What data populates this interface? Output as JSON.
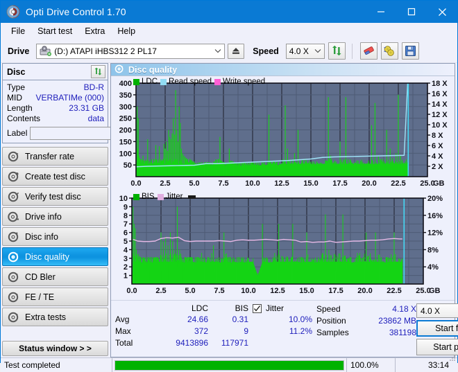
{
  "window": {
    "title": "Opti Drive Control 1.70",
    "icon": "disc-icon",
    "minimize": "minimize-icon",
    "maximize": "maximize-icon",
    "close": "close-icon"
  },
  "menu": [
    {
      "label": "File"
    },
    {
      "label": "Start test"
    },
    {
      "label": "Extra"
    },
    {
      "label": "Help"
    }
  ],
  "toolbar": {
    "drive_label": "Drive",
    "drive_value": "(D:)  ATAPI iHBS312  2 PL17",
    "eject_icon": "eject-icon",
    "speed_label": "Speed",
    "speed_value": "4.0 X",
    "refresh_icon": "refresh-icon",
    "erase_icon": "eraser-icon",
    "settings_icon": "gear-icon",
    "save_icon": "save-icon"
  },
  "disc_panel": {
    "title": "Disc",
    "refresh_icon": "refresh-icon",
    "rows": [
      {
        "key": "Type",
        "value": "BD-R"
      },
      {
        "key": "MID",
        "value": "VERBATIMe (000)"
      },
      {
        "key": "Length",
        "value": "23.31 GB"
      },
      {
        "key": "Contents",
        "value": "data"
      }
    ],
    "label_key": "Label",
    "label_value": "",
    "label_placeholder": "",
    "label_icon": "disc-yellow-icon"
  },
  "sidebar": {
    "items": [
      {
        "label": "Transfer rate",
        "icon": "disc-test-icon",
        "active": false
      },
      {
        "label": "Create test disc",
        "icon": "disc-test-icon",
        "active": false
      },
      {
        "label": "Verify test disc",
        "icon": "disc-test-icon",
        "active": false
      },
      {
        "label": "Drive info",
        "icon": "disc-test-icon",
        "active": false
      },
      {
        "label": "Disc info",
        "icon": "disc-test-icon",
        "active": false
      },
      {
        "label": "Disc quality",
        "icon": "disc-test-icon",
        "active": true
      },
      {
        "label": "CD Bler",
        "icon": "disc-test-icon",
        "active": false
      },
      {
        "label": "FE / TE",
        "icon": "disc-test-icon",
        "active": false
      },
      {
        "label": "Extra tests",
        "icon": "disc-test-icon",
        "active": false
      }
    ],
    "status_button": "Status window > >"
  },
  "main": {
    "title": "Disc quality",
    "title_icon": "disc-quality-icon"
  },
  "stats": {
    "col_headers": [
      "",
      "LDC",
      "BIS"
    ],
    "rows": [
      {
        "label": "Avg",
        "ldc": "24.66",
        "bis": "0.31",
        "jitter": "10.0%"
      },
      {
        "label": "Max",
        "ldc": "372",
        "bis": "9",
        "jitter": "11.2%"
      },
      {
        "label": "Total",
        "ldc": "9413896",
        "bis": "117971",
        "jitter": ""
      }
    ],
    "jitter_label": "Jitter",
    "jitter_checked": true,
    "speed_key": "Speed",
    "speed_value": "4.18 X",
    "position_key": "Position",
    "position_value": "23862 MB",
    "samples_key": "Samples",
    "samples_value": "381198",
    "speed_select": "4.0 X",
    "start_full": "Start full",
    "start_part": "Start part"
  },
  "statusbar": {
    "message": "Test completed",
    "progress_percent": "100.0%",
    "progress_value": 100,
    "elapsed": "33:14"
  },
  "chart_data": [
    {
      "type": "area",
      "name": "LDC / Read speed",
      "title": "",
      "xlabel": "GB",
      "ylabel": "",
      "xlim": [
        0.0,
        25.0
      ],
      "xticks": [
        "0.0",
        "2.5",
        "5.0",
        "7.5",
        "10.0",
        "12.5",
        "15.0",
        "17.5",
        "20.0",
        "22.5",
        "25.0"
      ],
      "x_unit": "GB",
      "ylim": [
        0,
        400
      ],
      "yticks": [
        "50",
        "100",
        "150",
        "200",
        "250",
        "300",
        "350",
        "400"
      ],
      "y2lim": [
        0,
        18
      ],
      "y2ticks": [
        "2 X",
        "4 X",
        "6 X",
        "8 X",
        "10 X",
        "12 X",
        "14 X",
        "16 X",
        "18 X"
      ],
      "grid": true,
      "plot_bg": "#5f6e8c",
      "legend": [
        {
          "label": "LDC",
          "color": "#00b000"
        },
        {
          "label": "Read speed",
          "color": "#92dcf4"
        },
        {
          "label": "Write speed",
          "color": "#ff5fd4"
        }
      ],
      "series": [
        {
          "name": "LDC",
          "color": "#15d415",
          "type": "area",
          "x": [
            0.05,
            0.1,
            0.15,
            0.2,
            0.25,
            0.3,
            0.35,
            0.4,
            0.5,
            0.6,
            0.7,
            0.8,
            0.9,
            1.0,
            1.1,
            1.2,
            1.3,
            1.4,
            1.5,
            1.6,
            1.7,
            1.8,
            1.9,
            2.0,
            2.1,
            2.2,
            2.3,
            2.4,
            2.5,
            2.6,
            2.7,
            2.8,
            2.9,
            3.0,
            3.1,
            3.2,
            3.3,
            3.4,
            3.5,
            3.6,
            3.7,
            3.8,
            3.9,
            4.0,
            4.1,
            4.2,
            4.3,
            4.4,
            4.5,
            4.6,
            4.7,
            4.8,
            4.9,
            5.0,
            5.2,
            5.4,
            5.6,
            5.8,
            6.0,
            6.2,
            6.4,
            6.6,
            6.8,
            7.0,
            7.2,
            7.4,
            7.6,
            7.8,
            8.0,
            8.2,
            8.4,
            8.6,
            8.8,
            9.0,
            9.2,
            9.4,
            9.6,
            9.8,
            10.0,
            10.3,
            10.6,
            10.9,
            11.2,
            11.4,
            11.5,
            11.7,
            11.9,
            12.2,
            12.5,
            12.8,
            13.0,
            13.1,
            13.3,
            13.6,
            13.9,
            14.2,
            14.4,
            14.6,
            14.8,
            15.0,
            15.3,
            15.6,
            15.9,
            16.2,
            16.5,
            16.7,
            16.9,
            17.0,
            17.2,
            17.5,
            17.8,
            18.0,
            18.3,
            18.5,
            18.8,
            19.0,
            19.3,
            19.6,
            19.9,
            20.2,
            20.5,
            20.8,
            21.0,
            21.3,
            21.5,
            21.8,
            22.0,
            22.3,
            22.5,
            22.7,
            22.9,
            23.1,
            23.3
          ],
          "y": [
            60,
            300,
            120,
            250,
            90,
            80,
            70,
            65,
            60,
            90,
            55,
            58,
            62,
            160,
            60,
            55,
            70,
            58,
            60,
            62,
            135,
            58,
            60,
            130,
            70,
            65,
            60,
            140,
            120,
            150,
            110,
            200,
            170,
            160,
            185,
            250,
            180,
            370,
            200,
            150,
            300,
            230,
            120,
            100,
            90,
            85,
            80,
            75,
            60,
            65,
            58,
            60,
            62,
            58,
            55,
            48,
            50,
            52,
            55,
            50,
            48,
            52,
            60,
            58,
            170,
            55,
            50,
            48,
            120,
            55,
            52,
            50,
            48,
            46,
            50,
            52,
            48,
            50,
            52,
            50,
            48,
            52,
            50,
            265,
            60,
            55,
            52,
            50,
            58,
            305,
            120,
            60,
            58,
            100,
            200,
            60,
            58,
            62,
            60,
            55,
            52,
            58,
            60,
            55,
            340,
            90,
            60,
            58,
            55,
            150,
            70,
            340,
            60,
            58,
            60,
            55,
            62,
            58,
            60,
            220,
            315,
            90,
            70,
            65,
            200,
            120,
            80,
            100,
            350,
            90,
            60,
            65,
            62,
            90
          ],
          "note": "LDC error counts sampled along disc, green filled area, baseline ~40-60 with spikes to 370"
        },
        {
          "name": "Read speed",
          "color": "#9fe4f8",
          "type": "line",
          "axis": "y2",
          "x": [
            0.0,
            1.0,
            2.0,
            3.0,
            4.0,
            5.0,
            6.0,
            7.0,
            8.0,
            9.0,
            10.0,
            11.0,
            12.0,
            13.0,
            14.0,
            15.0,
            16.0,
            17.0,
            18.0,
            19.0,
            20.0,
            21.0,
            22.0,
            23.0,
            23.3
          ],
          "y": [
            1.9,
            2.0,
            2.05,
            2.1,
            2.15,
            2.2,
            2.5,
            2.5,
            2.6,
            2.7,
            2.8,
            2.9,
            3.0,
            3.1,
            3.25,
            3.4,
            3.7,
            3.8,
            3.85,
            3.9,
            3.95,
            4.0,
            4.05,
            4.1,
            18.0
          ],
          "note": "read speed ramps 2X to ~4X then vertical cyan line at end of data"
        }
      ]
    },
    {
      "type": "area",
      "name": "BIS / Jitter",
      "title": "",
      "xlabel": "GB",
      "ylabel": "",
      "xlim": [
        0.0,
        25.0
      ],
      "xticks": [
        "0.0",
        "2.5",
        "5.0",
        "7.5",
        "10.0",
        "12.5",
        "15.0",
        "17.5",
        "20.0",
        "22.5",
        "25.0"
      ],
      "x_unit": "GB",
      "ylim": [
        0,
        10
      ],
      "yticks": [
        "1",
        "2",
        "3",
        "4",
        "5",
        "6",
        "7",
        "8",
        "9",
        "10"
      ],
      "y2lim": [
        0,
        20
      ],
      "y2ticks": [
        "4%",
        "8%",
        "12%",
        "16%",
        "20%"
      ],
      "grid": true,
      "plot_bg": "#5f6e8c",
      "legend": [
        {
          "label": "BIS",
          "color": "#00b000"
        },
        {
          "label": "Jitter",
          "color": "#e0aee0"
        }
      ],
      "series": [
        {
          "name": "BIS",
          "color": "#15d415",
          "type": "area",
          "x": [
            0.1,
            0.2,
            0.3,
            0.4,
            0.5,
            0.7,
            0.9,
            1.1,
            1.3,
            1.5,
            1.7,
            1.9,
            2.1,
            2.3,
            2.5,
            2.7,
            2.9,
            3.1,
            3.3,
            3.5,
            3.7,
            3.9,
            4.1,
            4.3,
            4.5,
            4.7,
            4.9,
            5.2,
            5.5,
            5.8,
            6.1,
            6.4,
            6.7,
            7.0,
            7.3,
            7.6,
            7.9,
            8.2,
            8.5,
            8.8,
            9.1,
            9.4,
            9.7,
            10.0,
            10.4,
            10.8,
            11.2,
            11.5,
            11.8,
            12.2,
            12.6,
            13.0,
            13.4,
            13.8,
            14.2,
            14.6,
            15.0,
            15.4,
            15.8,
            16.2,
            16.6,
            16.9,
            17.3,
            17.7,
            18.1,
            18.5,
            18.9,
            19.3,
            19.7,
            20.1,
            20.5,
            20.9,
            21.3,
            21.7,
            22.1,
            22.5,
            22.9,
            23.2
          ],
          "y": [
            9.0,
            7.0,
            6.5,
            4.0,
            3.0,
            3.0,
            2.5,
            3.0,
            2.5,
            3.0,
            2.5,
            3.0,
            2.5,
            3.0,
            6.0,
            5.0,
            5.5,
            4.5,
            6.0,
            5.0,
            4.0,
            9.0,
            4.0,
            3.0,
            2.5,
            3.0,
            2.5,
            3.0,
            2.5,
            3.0,
            3.0,
            2.5,
            3.0,
            4.5,
            3.0,
            2.5,
            6.0,
            3.0,
            2.5,
            3.0,
            2.5,
            3.0,
            2.5,
            3.0,
            3.0,
            1.0,
            7.0,
            3.0,
            2.5,
            3.0,
            7.0,
            3.0,
            3.0,
            7.0,
            3.0,
            2.5,
            6.0,
            3.0,
            2.5,
            3.0,
            8.1,
            4.0,
            3.0,
            3.0,
            8.1,
            3.0,
            2.5,
            3.0,
            3.0,
            6.0,
            3.0,
            6.0,
            3.0,
            2.5,
            3.0,
            6.0,
            3.0,
            3.0
          ],
          "note": "BIS error counts, dense green bars mostly 2-3 with spikes to 9"
        },
        {
          "name": "Jitter",
          "color": "#e6b9e6",
          "type": "line",
          "axis": "y2",
          "x": [
            0.1,
            0.5,
            1.0,
            1.5,
            2.0,
            2.5,
            3.0,
            3.5,
            4.0,
            4.5,
            5.0,
            5.5,
            6.0,
            6.5,
            7.0,
            7.5,
            8.0,
            8.5,
            9.0,
            9.5,
            10.0,
            10.5,
            11.0,
            11.5,
            12.0,
            12.5,
            13.0,
            13.5,
            14.0,
            14.5,
            15.0,
            15.5,
            16.0,
            16.5,
            17.0,
            17.5,
            18.0,
            18.5,
            19.0,
            19.5,
            20.0,
            20.5,
            21.0,
            21.5,
            22.0,
            22.5,
            23.0,
            23.2
          ],
          "y": [
            10.4,
            10.0,
            9.9,
            9.9,
            10.0,
            10.6,
            10.8,
            10.7,
            10.9,
            10.1,
            9.9,
            10.0,
            10.0,
            10.0,
            10.0,
            10.1,
            10.0,
            9.9,
            10.2,
            10.3,
            10.2,
            10.2,
            10.3,
            10.4,
            10.3,
            10.2,
            10.4,
            10.3,
            10.2,
            9.8,
            9.9,
            9.7,
            9.8,
            9.8,
            10.0,
            9.7,
            9.8,
            9.9,
            10.0,
            10.0,
            10.1,
            10.2,
            10.2,
            10.3,
            10.5,
            10.6,
            10.5,
            10.5
          ],
          "note": "jitter line hovering near 10% (value 5 on left scale)"
        }
      ]
    }
  ]
}
